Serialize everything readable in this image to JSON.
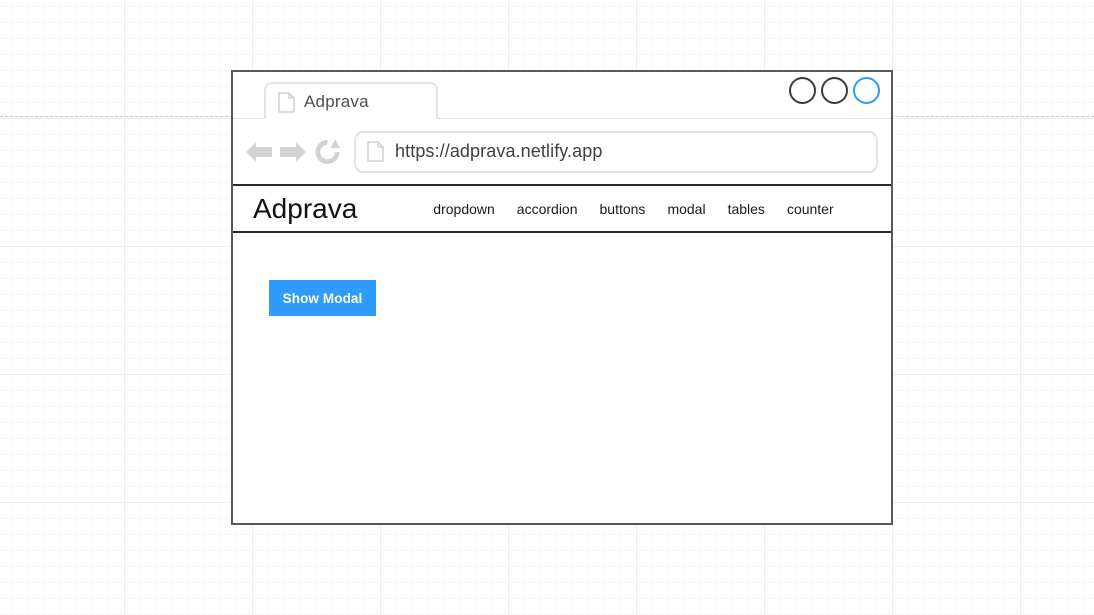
{
  "browser": {
    "tab": {
      "title": "Adprava",
      "favicon": "document-icon"
    },
    "window_controls": [
      {
        "name": "minimize",
        "color": "#3b3b3b"
      },
      {
        "name": "maximize",
        "color": "#3b3b3b"
      },
      {
        "name": "close",
        "color": "#2b9bf4"
      }
    ],
    "toolbar": {
      "back_icon": "arrow-left-icon",
      "forward_icon": "arrow-right-icon",
      "reload_icon": "reload-icon",
      "url_icon": "document-icon",
      "url": "https://adprava.netlify.app"
    }
  },
  "site": {
    "brand": "Adprava",
    "nav_links": [
      {
        "label": "dropdown"
      },
      {
        "label": "accordion"
      },
      {
        "label": "buttons"
      },
      {
        "label": "modal"
      },
      {
        "label": "tables"
      },
      {
        "label": "counter"
      }
    ],
    "content": {
      "show_modal_button": "Show Modal"
    }
  },
  "colors": {
    "accent_blue": "#2e9bfd",
    "window_border": "#595959",
    "navbar_border": "#2b2b2b",
    "grid_minor": "#f7f7f7",
    "grid_major": "#ededed",
    "guide_dash": "#c9c9c9"
  }
}
